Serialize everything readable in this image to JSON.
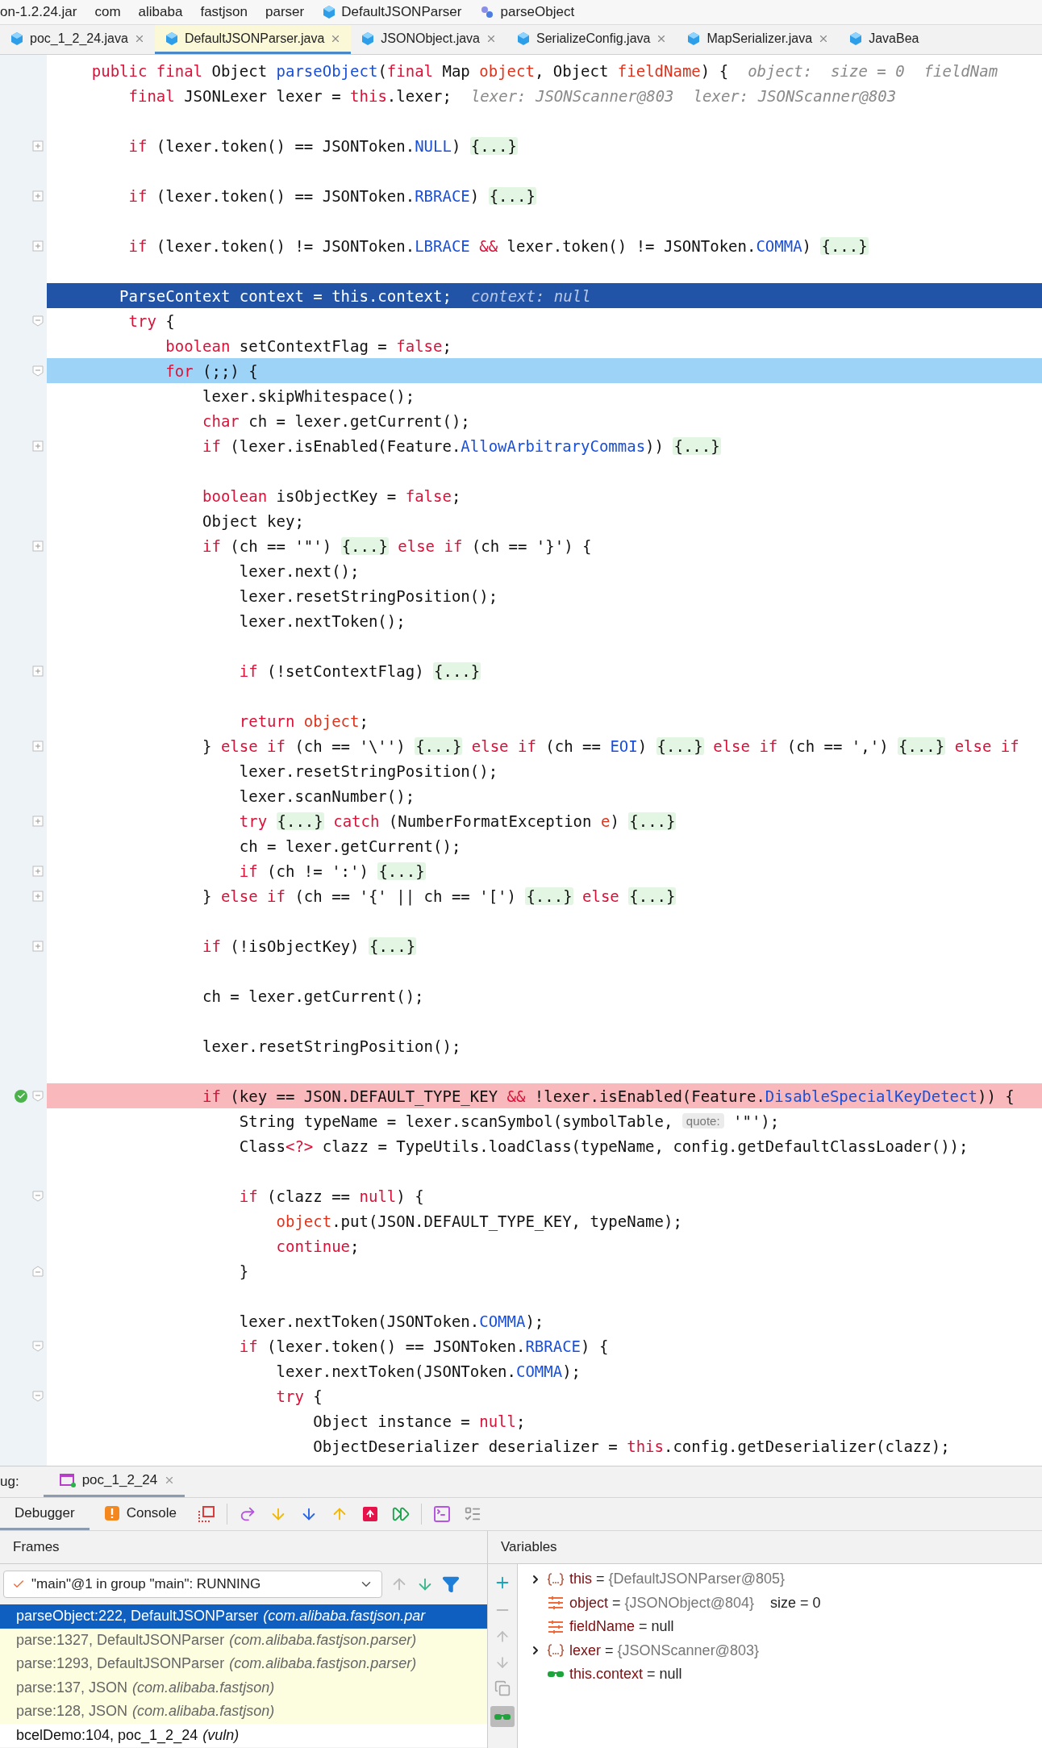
{
  "breadcrumbs": [
    {
      "label": "on-1.2.24.jar",
      "kind": "jar"
    },
    {
      "label": "com",
      "kind": "package"
    },
    {
      "label": "alibaba",
      "kind": "package"
    },
    {
      "label": "fastjson",
      "kind": "package"
    },
    {
      "label": "parser",
      "kind": "package"
    },
    {
      "label": "DefaultJSONParser",
      "kind": "class"
    },
    {
      "label": "parseObject",
      "kind": "method"
    }
  ],
  "tabs": [
    {
      "label": "poc_1_2_24.java",
      "selected": false
    },
    {
      "label": "DefaultJSONParser.java",
      "selected": true
    },
    {
      "label": "JSONObject.java",
      "selected": false
    },
    {
      "label": "SerializeConfig.java",
      "selected": false
    },
    {
      "label": "MapSerializer.java",
      "selected": false
    },
    {
      "label": "JavaBea",
      "selected": false
    }
  ],
  "code": [
    {
      "kind": "normal",
      "tokens": [
        {
          "kind": "keyword",
          "text": "    public final"
        },
        {
          "kind": "plain",
          "text": " Object "
        },
        {
          "kind": "method",
          "text": "parseObject"
        },
        {
          "kind": "plain",
          "text": "("
        },
        {
          "kind": "keyword",
          "text": "final"
        },
        {
          "kind": "plain",
          "text": " Map "
        },
        {
          "kind": "param",
          "text": "object"
        },
        {
          "kind": "plain",
          "text": ", Object "
        },
        {
          "kind": "param",
          "text": "fieldName"
        },
        {
          "kind": "plain",
          "text": ") {"
        },
        {
          "kind": "hint",
          "text": "object:  size = 0"
        },
        {
          "kind": "hint",
          "text": "fieldNam"
        }
      ]
    },
    {
      "kind": "normal",
      "tokens": [
        {
          "kind": "keyword",
          "text": "        final"
        },
        {
          "kind": "plain",
          "text": " JSONLexer lexer = "
        },
        {
          "kind": "keyword",
          "text": "this"
        },
        {
          "kind": "plain",
          "text": ".lexer;"
        },
        {
          "kind": "hint",
          "text": "lexer: JSONScanner@803"
        },
        {
          "kind": "hint",
          "text": "lexer: JSONScanner@803"
        }
      ]
    },
    {
      "kind": "normal"
    },
    {
      "kind": "normal",
      "gutter": {
        "kind": "plus"
      },
      "tokens": [
        {
          "kind": "keyword",
          "text": "        if"
        },
        {
          "kind": "plain",
          "text": " (lexer.token() == JSONToken."
        },
        {
          "kind": "const",
          "text": "NULL"
        },
        {
          "kind": "plain",
          "text": ") "
        },
        {
          "kind": "fold",
          "text": "{...}"
        }
      ]
    },
    {
      "kind": "normal"
    },
    {
      "kind": "normal",
      "gutter": {
        "kind": "plus"
      },
      "tokens": [
        {
          "kind": "keyword",
          "text": "        if"
        },
        {
          "kind": "plain",
          "text": " (lexer.token() == JSONToken."
        },
        {
          "kind": "const",
          "text": "RBRACE"
        },
        {
          "kind": "plain",
          "text": ") "
        },
        {
          "kind": "fold",
          "text": "{...}"
        }
      ]
    },
    {
      "kind": "normal"
    },
    {
      "kind": "normal",
      "gutter": {
        "kind": "plus"
      },
      "tokens": [
        {
          "kind": "keyword",
          "text": "        if"
        },
        {
          "kind": "plain",
          "text": " (lexer.token() != JSONToken."
        },
        {
          "kind": "const",
          "text": "LBRACE"
        },
        {
          "kind": "keyword",
          "text": " &&"
        },
        {
          "kind": "plain",
          "text": " lexer.token() != JSONToken."
        },
        {
          "kind": "const",
          "text": "COMMA"
        },
        {
          "kind": "plain",
          "text": ") "
        },
        {
          "kind": "fold",
          "text": "{...}"
        }
      ]
    },
    {
      "kind": "normal"
    },
    {
      "kind": "execution",
      "tokens": [
        {
          "kind": "plain",
          "text": "       ParseContext context = this.context;"
        },
        {
          "kind": "hint",
          "text": "context: null"
        }
      ]
    },
    {
      "kind": "normal",
      "gutter": {
        "kind": "minus"
      },
      "tokens": [
        {
          "kind": "keyword",
          "text": "        try"
        },
        {
          "kind": "plain",
          "text": " {"
        }
      ]
    },
    {
      "kind": "normal",
      "tokens": [
        {
          "kind": "keyword",
          "text": "            boolean"
        },
        {
          "kind": "plain",
          "text": " setContextFlag = "
        },
        {
          "kind": "keyword",
          "text": "false"
        },
        {
          "kind": "plain",
          "text": ";"
        }
      ]
    },
    {
      "kind": "current",
      "gutter": {
        "kind": "minus"
      },
      "tokens": [
        {
          "kind": "keyword",
          "text": "            for"
        },
        {
          "kind": "plain",
          "text": " (;;) {"
        }
      ]
    },
    {
      "kind": "normal",
      "tokens": [
        {
          "kind": "plain",
          "text": "                lexer.skipWhitespace();"
        }
      ]
    },
    {
      "kind": "normal",
      "tokens": [
        {
          "kind": "keyword",
          "text": "                char"
        },
        {
          "kind": "plain",
          "text": " ch = lexer.getCurrent();"
        }
      ]
    },
    {
      "kind": "normal",
      "gutter": {
        "kind": "plus"
      },
      "tokens": [
        {
          "kind": "keyword",
          "text": "                if"
        },
        {
          "kind": "plain",
          "text": " (lexer.isEnabled(Feature."
        },
        {
          "kind": "const",
          "text": "AllowArbitraryCommas"
        },
        {
          "kind": "plain",
          "text": ")) "
        },
        {
          "kind": "fold",
          "text": "{...}"
        }
      ]
    },
    {
      "kind": "normal"
    },
    {
      "kind": "normal",
      "tokens": [
        {
          "kind": "keyword",
          "text": "                boolean"
        },
        {
          "kind": "plain",
          "text": " isObjectKey = "
        },
        {
          "kind": "keyword",
          "text": "false"
        },
        {
          "kind": "plain",
          "text": ";"
        }
      ]
    },
    {
      "kind": "normal",
      "tokens": [
        {
          "kind": "plain",
          "text": "                Object key;"
        }
      ]
    },
    {
      "kind": "normal",
      "gutter": {
        "kind": "plus"
      },
      "tokens": [
        {
          "kind": "keyword",
          "text": "                if"
        },
        {
          "kind": "plain",
          "text": " (ch == '\"') "
        },
        {
          "kind": "fold",
          "text": "{...}"
        },
        {
          "kind": "keyword",
          "text": " else if"
        },
        {
          "kind": "plain",
          "text": " (ch == '}') {"
        }
      ]
    },
    {
      "kind": "normal",
      "tokens": [
        {
          "kind": "plain",
          "text": "                    lexer.next();"
        }
      ]
    },
    {
      "kind": "normal",
      "tokens": [
        {
          "kind": "plain",
          "text": "                    lexer.resetStringPosition();"
        }
      ]
    },
    {
      "kind": "normal",
      "tokens": [
        {
          "kind": "plain",
          "text": "                    lexer.nextToken();"
        }
      ]
    },
    {
      "kind": "normal"
    },
    {
      "kind": "normal",
      "gutter": {
        "kind": "plus"
      },
      "tokens": [
        {
          "kind": "keyword",
          "text": "                    if"
        },
        {
          "kind": "plain",
          "text": " (!setContextFlag) "
        },
        {
          "kind": "fold",
          "text": "{...}"
        }
      ]
    },
    {
      "kind": "normal"
    },
    {
      "kind": "normal",
      "tokens": [
        {
          "kind": "keyword",
          "text": "                    return"
        },
        {
          "kind": "param",
          "text": " object"
        },
        {
          "kind": "plain",
          "text": ";"
        }
      ]
    },
    {
      "kind": "normal",
      "gutter": {
        "kind": "plus"
      },
      "tokens": [
        {
          "kind": "plain",
          "text": "                } "
        },
        {
          "kind": "keyword",
          "text": "else if"
        },
        {
          "kind": "plain",
          "text": " (ch == '\\'') "
        },
        {
          "kind": "fold",
          "text": "{...}"
        },
        {
          "kind": "keyword",
          "text": " else if"
        },
        {
          "kind": "plain",
          "text": " (ch == "
        },
        {
          "kind": "const",
          "text": "EOI"
        },
        {
          "kind": "plain",
          "text": ") "
        },
        {
          "kind": "fold",
          "text": "{...}"
        },
        {
          "kind": "keyword",
          "text": " else if"
        },
        {
          "kind": "plain",
          "text": " (ch == ',') "
        },
        {
          "kind": "fold",
          "text": "{...}"
        },
        {
          "kind": "keyword",
          "text": " else if"
        }
      ]
    },
    {
      "kind": "normal",
      "tokens": [
        {
          "kind": "plain",
          "text": "                    lexer.resetStringPosition();"
        }
      ]
    },
    {
      "kind": "normal",
      "tokens": [
        {
          "kind": "plain",
          "text": "                    lexer.scanNumber();"
        }
      ]
    },
    {
      "kind": "normal",
      "gutter": {
        "kind": "plus"
      },
      "tokens": [
        {
          "kind": "keyword",
          "text": "                    try "
        },
        {
          "kind": "fold",
          "text": "{...}"
        },
        {
          "kind": "keyword",
          "text": " catch"
        },
        {
          "kind": "plain",
          "text": " (NumberFormatException "
        },
        {
          "kind": "param",
          "text": "e"
        },
        {
          "kind": "plain",
          "text": ") "
        },
        {
          "kind": "fold",
          "text": "{...}"
        }
      ]
    },
    {
      "kind": "normal",
      "tokens": [
        {
          "kind": "plain",
          "text": "                    ch = lexer.getCurrent();"
        }
      ]
    },
    {
      "kind": "normal",
      "gutter": {
        "kind": "plus"
      },
      "tokens": [
        {
          "kind": "keyword",
          "text": "                    if"
        },
        {
          "kind": "plain",
          "text": " (ch != ':') "
        },
        {
          "kind": "fold",
          "text": "{...}"
        }
      ]
    },
    {
      "kind": "normal",
      "gutter": {
        "kind": "plus"
      },
      "tokens": [
        {
          "kind": "plain",
          "text": "                } "
        },
        {
          "kind": "keyword",
          "text": "else if"
        },
        {
          "kind": "plain",
          "text": " (ch == '{' || ch == '[') "
        },
        {
          "kind": "fold",
          "text": "{...}"
        },
        {
          "kind": "keyword",
          "text": " else "
        },
        {
          "kind": "fold",
          "text": "{...}"
        }
      ]
    },
    {
      "kind": "normal"
    },
    {
      "kind": "normal",
      "gutter": {
        "kind": "plus"
      },
      "tokens": [
        {
          "kind": "keyword",
          "text": "                if"
        },
        {
          "kind": "plain",
          "text": " (!isObjectKey) "
        },
        {
          "kind": "fold",
          "text": "{...}"
        }
      ]
    },
    {
      "kind": "normal"
    },
    {
      "kind": "normal",
      "tokens": [
        {
          "kind": "plain",
          "text": "                ch = lexer.getCurrent();"
        }
      ]
    },
    {
      "kind": "normal"
    },
    {
      "kind": "normal",
      "tokens": [
        {
          "kind": "plain",
          "text": "                lexer.resetStringPosition();"
        }
      ]
    },
    {
      "kind": "normal"
    },
    {
      "kind": "breakpoint",
      "gutter": {
        "kind": "minus"
      },
      "tokens": [
        {
          "kind": "keyword",
          "text": "                if"
        },
        {
          "kind": "plain",
          "text": " (key == JSON.DEFAULT_TYPE_KEY "
        },
        {
          "kind": "keyword",
          "text": "&&"
        },
        {
          "kind": "plain",
          "text": " !lexer.isEnabled(Feature."
        },
        {
          "kind": "const",
          "text": "DisableSpecialKeyDetect"
        },
        {
          "kind": "plain",
          "text": ")) {"
        }
      ]
    },
    {
      "kind": "normal",
      "tokens": [
        {
          "kind": "plain",
          "text": "                    String typeName = lexer.scanSymbol(symbolTable, "
        },
        {
          "kind": "param_hint",
          "text": "quote:"
        },
        {
          "kind": "plain",
          "text": " '\"');"
        }
      ]
    },
    {
      "kind": "normal",
      "tokens": [
        {
          "kind": "plain",
          "text": "                    Class"
        },
        {
          "kind": "keyword",
          "text": "<?>"
        },
        {
          "kind": "plain",
          "text": " clazz = TypeUtils.loadClass(typeName, config.getDefaultClassLoader());"
        }
      ]
    },
    {
      "kind": "normal"
    },
    {
      "kind": "normal",
      "gutter": {
        "kind": "minus"
      },
      "tokens": [
        {
          "kind": "keyword",
          "text": "                    if"
        },
        {
          "kind": "plain",
          "text": " (clazz == "
        },
        {
          "kind": "keyword",
          "text": "null"
        },
        {
          "kind": "plain",
          "text": ") {"
        }
      ]
    },
    {
      "kind": "normal",
      "tokens": [
        {
          "kind": "param",
          "text": "                        object"
        },
        {
          "kind": "plain",
          "text": ".put(JSON.DEFAULT_TYPE_KEY, typeName);"
        }
      ]
    },
    {
      "kind": "normal",
      "tokens": [
        {
          "kind": "keyword",
          "text": "                        continue"
        },
        {
          "kind": "plain",
          "text": ";"
        }
      ]
    },
    {
      "kind": "normal",
      "gutter": {
        "kind": "end"
      },
      "tokens": [
        {
          "kind": "plain",
          "text": "                    }"
        }
      ]
    },
    {
      "kind": "normal"
    },
    {
      "kind": "normal",
      "tokens": [
        {
          "kind": "plain",
          "text": "                    lexer.nextToken(JSONToken."
        },
        {
          "kind": "const",
          "text": "COMMA"
        },
        {
          "kind": "plain",
          "text": ");"
        }
      ]
    },
    {
      "kind": "normal",
      "gutter": {
        "kind": "minus"
      },
      "tokens": [
        {
          "kind": "keyword",
          "text": "                    if"
        },
        {
          "kind": "plain",
          "text": " (lexer.token() == JSONToken."
        },
        {
          "kind": "const",
          "text": "RBRACE"
        },
        {
          "kind": "plain",
          "text": ") {"
        }
      ]
    },
    {
      "kind": "normal",
      "tokens": [
        {
          "kind": "plain",
          "text": "                        lexer.nextToken(JSONToken."
        },
        {
          "kind": "const",
          "text": "COMMA"
        },
        {
          "kind": "plain",
          "text": ");"
        }
      ]
    },
    {
      "kind": "normal",
      "gutter": {
        "kind": "minus"
      },
      "tokens": [
        {
          "kind": "keyword",
          "text": "                        try"
        },
        {
          "kind": "plain",
          "text": " {"
        }
      ]
    },
    {
      "kind": "normal",
      "tokens": [
        {
          "kind": "plain",
          "text": "                            Object instance = "
        },
        {
          "kind": "keyword",
          "text": "null"
        },
        {
          "kind": "plain",
          "text": ";"
        }
      ]
    },
    {
      "kind": "normal",
      "tokens": [
        {
          "kind": "plain",
          "text": "                            ObjectDeserializer deserializer = "
        },
        {
          "kind": "keyword",
          "text": "this"
        },
        {
          "kind": "plain",
          "text": ".config.getDeserializer(clazz);"
        }
      ]
    }
  ],
  "debug": {
    "label": "ug:",
    "session_tab": "poc_1_2_24",
    "tabs": [
      {
        "label": "Debugger",
        "selected": true
      },
      {
        "label": "Console",
        "selected": false
      }
    ],
    "frames": {
      "title": "Frames",
      "thread": "\"main\"@1 in group \"main\": RUNNING",
      "items": [
        {
          "method": "parseObject:222, DefaultJSONParser",
          "package": "(com.alibaba.fastjson.par",
          "selected": true,
          "library": true
        },
        {
          "method": "parse:1327, DefaultJSONParser",
          "package": "(com.alibaba.fastjson.parser)",
          "selected": false,
          "library": true
        },
        {
          "method": "parse:1293, DefaultJSONParser",
          "package": "(com.alibaba.fastjson.parser)",
          "selected": false,
          "library": true
        },
        {
          "method": "parse:137, JSON",
          "package": "(com.alibaba.fastjson)",
          "selected": false,
          "library": true
        },
        {
          "method": "parse:128, JSON",
          "package": "(com.alibaba.fastjson)",
          "selected": false,
          "library": true
        },
        {
          "method": "bcelDemo:104, poc_1_2_24",
          "package": "(vuln)",
          "selected": false,
          "library": false
        }
      ]
    },
    "variables": {
      "title": "Variables",
      "items": [
        {
          "kind": "object",
          "expandable": true,
          "name": "this",
          "operator": "=",
          "value": "{DefaultJSONParser@805}",
          "value_dimmed": true
        },
        {
          "kind": "param",
          "expandable": false,
          "name": "object",
          "operator": "=",
          "value": "{JSONObject@804}",
          "value_dimmed": true,
          "extra": "size = 0"
        },
        {
          "kind": "param",
          "expandable": false,
          "name": "fieldName",
          "operator": "=",
          "value": "null",
          "value_dimmed": false
        },
        {
          "kind": "object",
          "expandable": true,
          "name": "lexer",
          "operator": "=",
          "value": "{JSONScanner@803}",
          "value_dimmed": true
        },
        {
          "kind": "watch",
          "expandable": false,
          "name": "this.context",
          "operator": "=",
          "value": "null",
          "value_dimmed": false
        }
      ]
    }
  }
}
